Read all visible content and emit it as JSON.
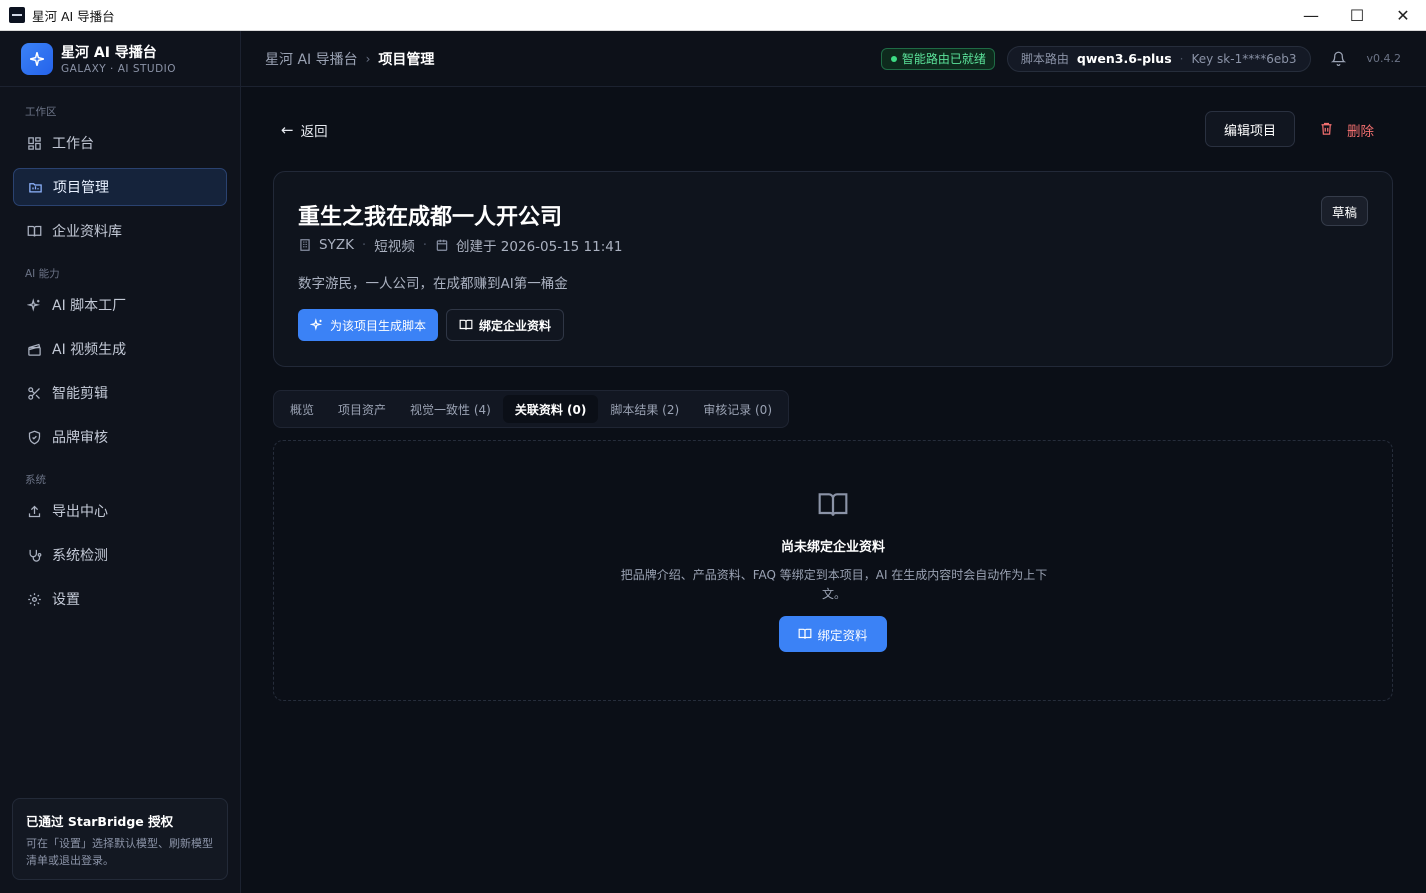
{
  "window": {
    "title": "星河 AI 导播台",
    "minimize": "—",
    "maximize": "☐",
    "close": "✕"
  },
  "brand": {
    "name": "星河 AI 导播台",
    "subtitle": "GALAXY · AI STUDIO"
  },
  "sidebar": {
    "sections": [
      {
        "label": "工作区"
      },
      {
        "label": "AI 能力"
      },
      {
        "label": "系统"
      }
    ],
    "items": [
      {
        "label": "工作台",
        "icon": "dashboard-grid-icon"
      },
      {
        "label": "项目管理",
        "icon": "folder-icon"
      },
      {
        "label": "企业资料库",
        "icon": "book-icon"
      },
      {
        "label": "AI 脚本工厂",
        "icon": "sparkles-icon"
      },
      {
        "label": "AI 视频生成",
        "icon": "clapperboard-icon"
      },
      {
        "label": "智能剪辑",
        "icon": "scissors-icon"
      },
      {
        "label": "品牌审核",
        "icon": "shield-check-icon"
      },
      {
        "label": "导出中心",
        "icon": "upload-icon"
      },
      {
        "label": "系统检测",
        "icon": "stethoscope-icon"
      },
      {
        "label": "设置",
        "icon": "gear-icon"
      }
    ],
    "auth": {
      "title": "已通过 StarBridge 授权",
      "desc": "可在「设置」选择默认模型、刷新模型清单或退出登录。"
    }
  },
  "header": {
    "breadcrumb": [
      "星河 AI 导播台",
      "项目管理"
    ],
    "status": "智能路由已就绪",
    "route_label": "脚本路由",
    "model": "qwen3.6-plus",
    "key": "Key sk-1****6eb3",
    "version": "v0.4.2"
  },
  "main": {
    "back": "返回",
    "edit": "编辑项目",
    "delete": "删除",
    "project": {
      "title": "重生之我在成都一人开公司",
      "badge": "草稿",
      "company": "SYZK",
      "type": "短视频",
      "created": "创建于 2026-05-15 11:41",
      "desc": "数字游民，一人公司，在成都赚到AI第一桶金",
      "btn_generate": "为该项目生成脚本",
      "btn_bind": "绑定企业资料"
    },
    "tabs": [
      "概览",
      "项目资产",
      "视觉一致性 (4)",
      "关联资料 (0)",
      "脚本结果 (2)",
      "审核记录 (0)"
    ],
    "active_tab": "关联资料 (0)",
    "empty": {
      "title": "尚未绑定企业资料",
      "desc": "把品牌介绍、产品资料、FAQ 等绑定到本项目，AI 在生成内容时会自动作为上下文。",
      "button": "绑定资料"
    }
  },
  "colors": {
    "accent": "#3b82f6",
    "success": "#3ddc84",
    "danger": "#f16f6f",
    "background": "#0b0f17"
  }
}
